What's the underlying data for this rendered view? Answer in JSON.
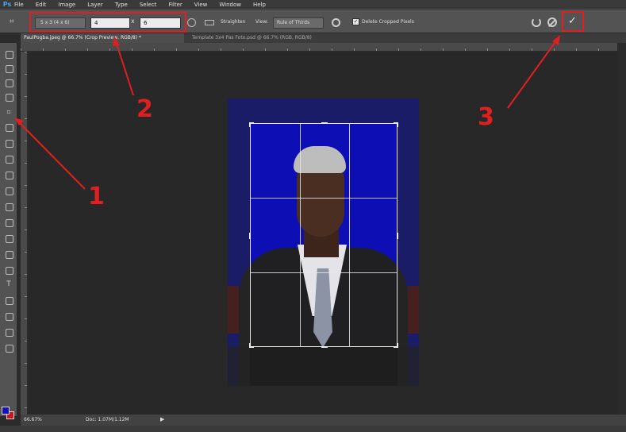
{
  "app": {
    "logo": "Ps"
  },
  "menu": [
    "File",
    "Edit",
    "Image",
    "Layer",
    "Type",
    "Select",
    "Filter",
    "View",
    "Window",
    "Help"
  ],
  "options_bar": {
    "ratio_preset": "5 x 3 (4 x 6)",
    "width_value": "4",
    "swap_symbol": "x",
    "height_value": "6",
    "straighten_label": "Straighten",
    "view_label": "View:",
    "view_value": "Rule of Thirds",
    "delete_cropped_label": "Delete Cropped Pixels",
    "delete_cropped_checked": true,
    "commit_symbol": "✓"
  },
  "tabs": [
    {
      "label": "PaulPogba.jpeg @ 66.7% (Crop Preview, RGB/8) *",
      "active": true
    },
    {
      "label": "Template 3x4 Pas Foto.psd @ 66.7% (RGB, RGB/8)",
      "active": false
    }
  ],
  "annotations": [
    "1",
    "2",
    "3"
  ],
  "status": {
    "zoom": "66.67%",
    "doc_info": "Doc: 1.07M/1.12M",
    "arrow": "▶"
  },
  "colors": {
    "foreground": "#1010c0",
    "background": "#d21414",
    "annotation": "#e02020",
    "doc_background": "#0d0fb5"
  },
  "icons": {
    "crop_tool": "crop-icon",
    "reset": "reset-icon",
    "cancel": "cancel-icon",
    "commit": "checkmark-icon",
    "gear": "gear-icon"
  }
}
